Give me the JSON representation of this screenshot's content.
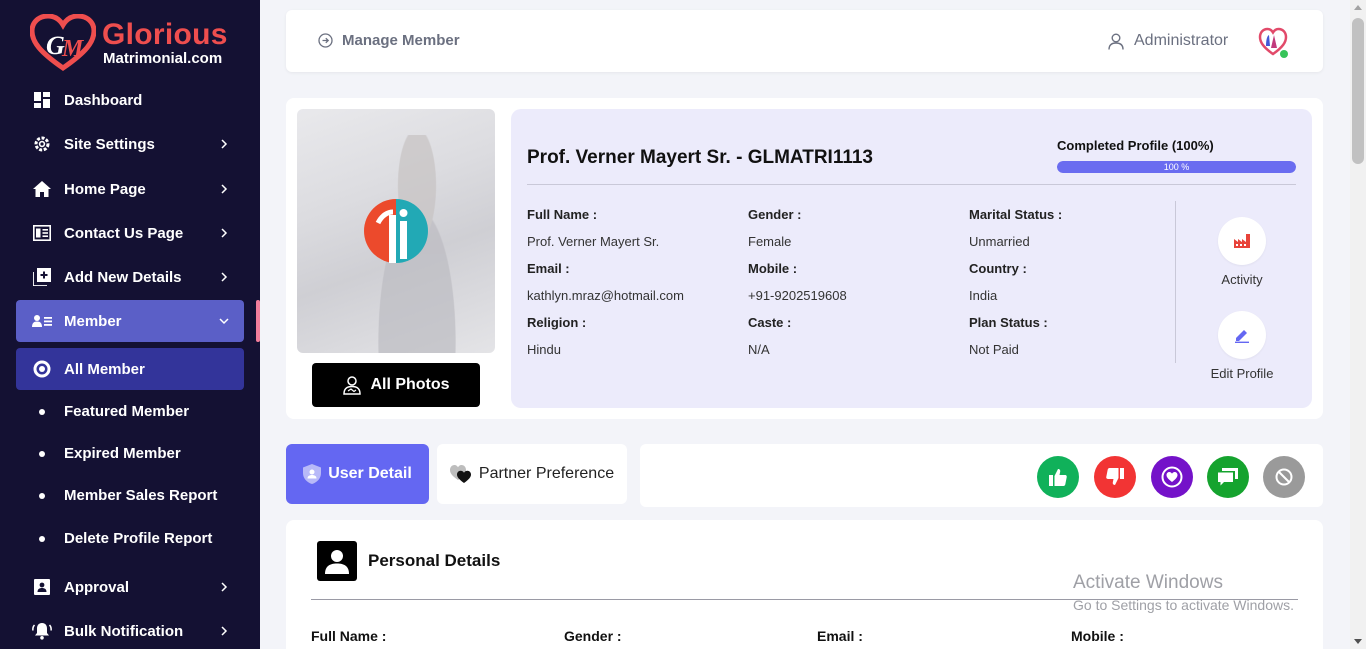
{
  "brand": {
    "name": "Glorious",
    "sub": "Matrimonial.com"
  },
  "sidebar": {
    "items": [
      {
        "label": "Dashboard"
      },
      {
        "label": "Site Settings"
      },
      {
        "label": "Home Page"
      },
      {
        "label": "Contact Us Page"
      },
      {
        "label": "Add New Details"
      },
      {
        "label": "Member"
      }
    ],
    "member_sub": [
      {
        "label": "All Member"
      },
      {
        "label": "Featured Member"
      },
      {
        "label": "Expired Member"
      },
      {
        "label": "Member Sales Report"
      },
      {
        "label": "Delete Profile Report"
      }
    ],
    "bottom_items": [
      {
        "label": "Approval"
      },
      {
        "label": "Bulk Notification"
      }
    ]
  },
  "header": {
    "breadcrumb": "Manage Member",
    "user": "Administrator"
  },
  "profile": {
    "title": "Prof. Verner Mayert Sr. - GLMATRI1113",
    "completed_label": "Completed Profile (100%)",
    "progress": 100,
    "progress_text": "100 %",
    "all_photos": "All Photos",
    "fields": {
      "full_name_label": "Full Name :",
      "full_name": "Prof. Verner Mayert Sr.",
      "gender_label": "Gender :",
      "gender": "Female",
      "marital_label": "Marital Status :",
      "marital": "Unmarried",
      "email_label": "Email :",
      "email": "kathlyn.mraz@hotmail.com",
      "mobile_label": "Mobile :",
      "mobile": "+91-9202519608",
      "country_label": "Country :",
      "country": "India",
      "religion_label": "Religion :",
      "religion": "Hindu",
      "caste_label": "Caste :",
      "caste": "N/A",
      "plan_label": "Plan Status :",
      "plan": "Not Paid"
    },
    "actions": {
      "activity": "Activity",
      "edit": "Edit Profile"
    }
  },
  "tabs": {
    "user_detail": "User Detail",
    "partner_pref": "Partner Preference"
  },
  "action_colors": {
    "like": "#10b15a",
    "dislike": "#f23434",
    "favorite": "#7412c9",
    "chat": "#15a32e",
    "block": "#9a9a9a"
  },
  "personal": {
    "title": "Personal Details",
    "labels": {
      "full_name": "Full Name :",
      "gender": "Gender :",
      "email": "Email :",
      "mobile": "Mobile :"
    }
  },
  "watermark": {
    "line1": "Activate Windows",
    "line2": "Go to Settings to activate Windows."
  }
}
